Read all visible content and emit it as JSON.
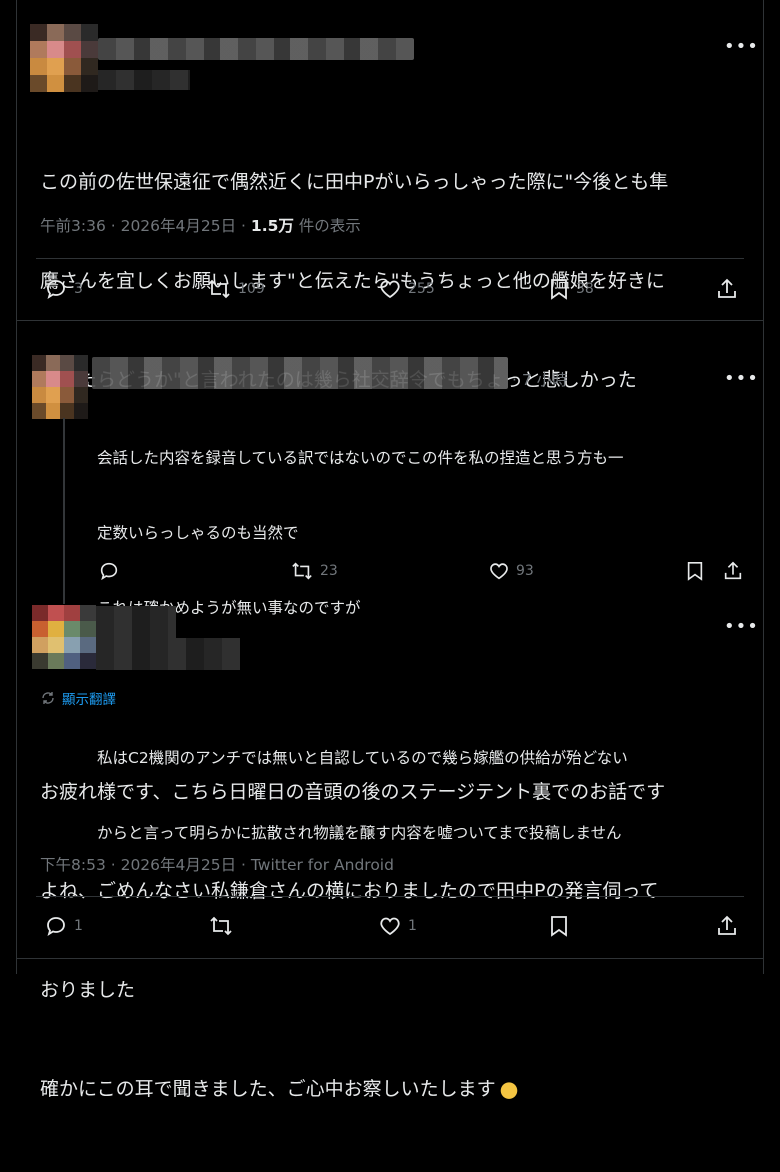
{
  "main_tweet": {
    "body": "この前の佐世保遠征で偶然近くに田中Pがいらっしゃった際に\"今後とも隼鷹さんを宜しくお願いします\"と伝えたら\"もうちょっと他の艦娘を好きになったらどうか\"と言われたのは幾ら社交辞令でもちょっと悲しかった",
    "line1": "この前の佐世保遠征で偶然近くに田中Pがいらっしゃった際に\"今後とも隼",
    "line2": "鷹さんを宜しくお願いします\"と伝えたら\"もうちょっと他の艦娘を好きに",
    "line3": "なったらどうか\"と言われたのは幾ら社交辞令でもちょっと悲しかった",
    "time": "午前3:36 · 2026年4月25日 · ",
    "views_count": "1.5万",
    "views_label": " 件の表示",
    "replies": "3",
    "retweets": "109",
    "likes": "255",
    "bookmarks": "38"
  },
  "reply1": {
    "age": "· 7 小時",
    "line1": "会話した内容を録音している訳ではないのでこの件を私の捏造と思う方も一",
    "line2": "定数いらっしゃるのも当然で",
    "line3": "これは確かめようが無い事なのですが",
    "line4": "私はC2機関のアンチでは無いと自認しているので幾ら嫁艦の供給が殆どない",
    "line5": "からと言って明らかに拡散され物議を醸す内容を嘘ついてまで投稿しません",
    "retweets": "23",
    "likes": "93"
  },
  "reply2": {
    "translate_label": "顯示翻譯",
    "line1": "お疲れ様です、こちら日曜日の音頭の後のステージテント裏でのお話です",
    "line2": "よね、ごめんなさい私鎌倉さんの横におりましたので田中Pの発言伺って",
    "line3": "おりました",
    "line4": "確かにこの耳で聞きました、ご心中お察しいたします",
    "time": "下午8:53 · 2026年4月25日 · Twitter for Android",
    "replies": "1",
    "likes": "1"
  },
  "icons": [
    "more-icon",
    "reply-icon",
    "retweet-icon",
    "like-icon",
    "bookmark-icon",
    "share-icon",
    "translate-icon",
    "emoji-icon"
  ]
}
